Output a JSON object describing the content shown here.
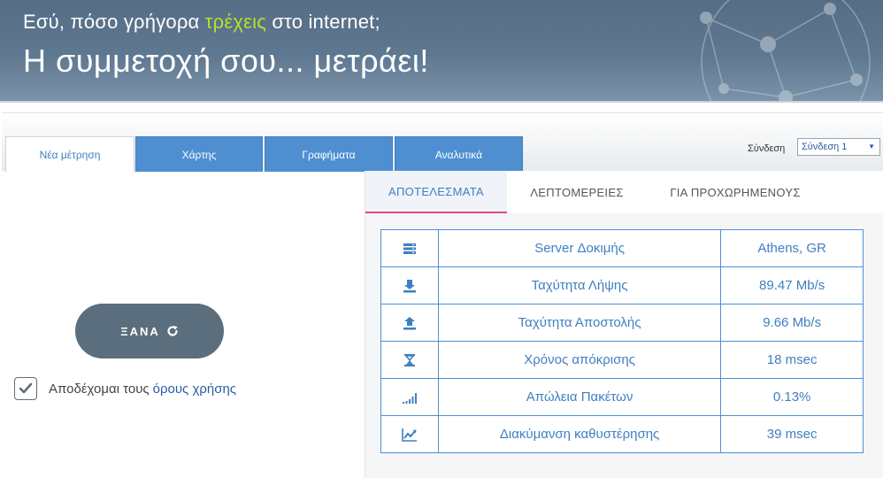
{
  "banner": {
    "line1_before": "Εσύ, πόσο γρήγορα ",
    "line1_highlight": "τρέχεις",
    "line1_after": " στο internet;",
    "line2": "Η συμμετοχή σου... μετράει!"
  },
  "tabs": [
    {
      "label": "Νέα μέτρηση",
      "active": true
    },
    {
      "label": "Χάρτης",
      "active": false
    },
    {
      "label": "Γραφήματα",
      "active": false
    },
    {
      "label": "Αναλυτικά",
      "active": false
    }
  ],
  "connection": {
    "label": "Σύνδεση",
    "selected": "Σύνδεση 1"
  },
  "left": {
    "again_label": "ΞΑΝΑ",
    "again_icon": "refresh-icon",
    "terms_checked": true,
    "terms_text": "Αποδέχομαι τους",
    "terms_link": "όρους χρήσης"
  },
  "subtabs": [
    {
      "label": "ΑΠΟΤΕΛΕΣΜΑΤΑ",
      "active": true
    },
    {
      "label": "ΛΕΠΤΟΜΕΡΕΙΕΣ",
      "active": false
    },
    {
      "label": "ΓΙΑ ΠΡΟΧΩΡΗΜΕΝΟΥΣ",
      "active": false
    }
  ],
  "results": [
    {
      "icon": "server-icon",
      "label": "Server Δοκιμής",
      "value": "Athens, GR"
    },
    {
      "icon": "download-icon",
      "label": "Ταχύτητα Λήψης",
      "value": "89.47 Mb/s"
    },
    {
      "icon": "upload-icon",
      "label": "Ταχύτητα Αποστολής",
      "value": "9.66 Mb/s"
    },
    {
      "icon": "hourglass-icon",
      "label": "Χρόνος απόκρισης",
      "value": "18 msec"
    },
    {
      "icon": "signal-bars-icon",
      "label": "Απώλεια Πακέτων",
      "value": "0.13%"
    },
    {
      "icon": "line-chart-icon",
      "label": "Διακύμανση καθυστέρησης",
      "value": "39 msec"
    }
  ],
  "colors": {
    "accent": "#4f8fd1",
    "text_blue": "#3f7fc2",
    "highlight_green": "#b8e02c",
    "button_gray": "#5b6e7d",
    "active_underline": "#e8467a"
  }
}
